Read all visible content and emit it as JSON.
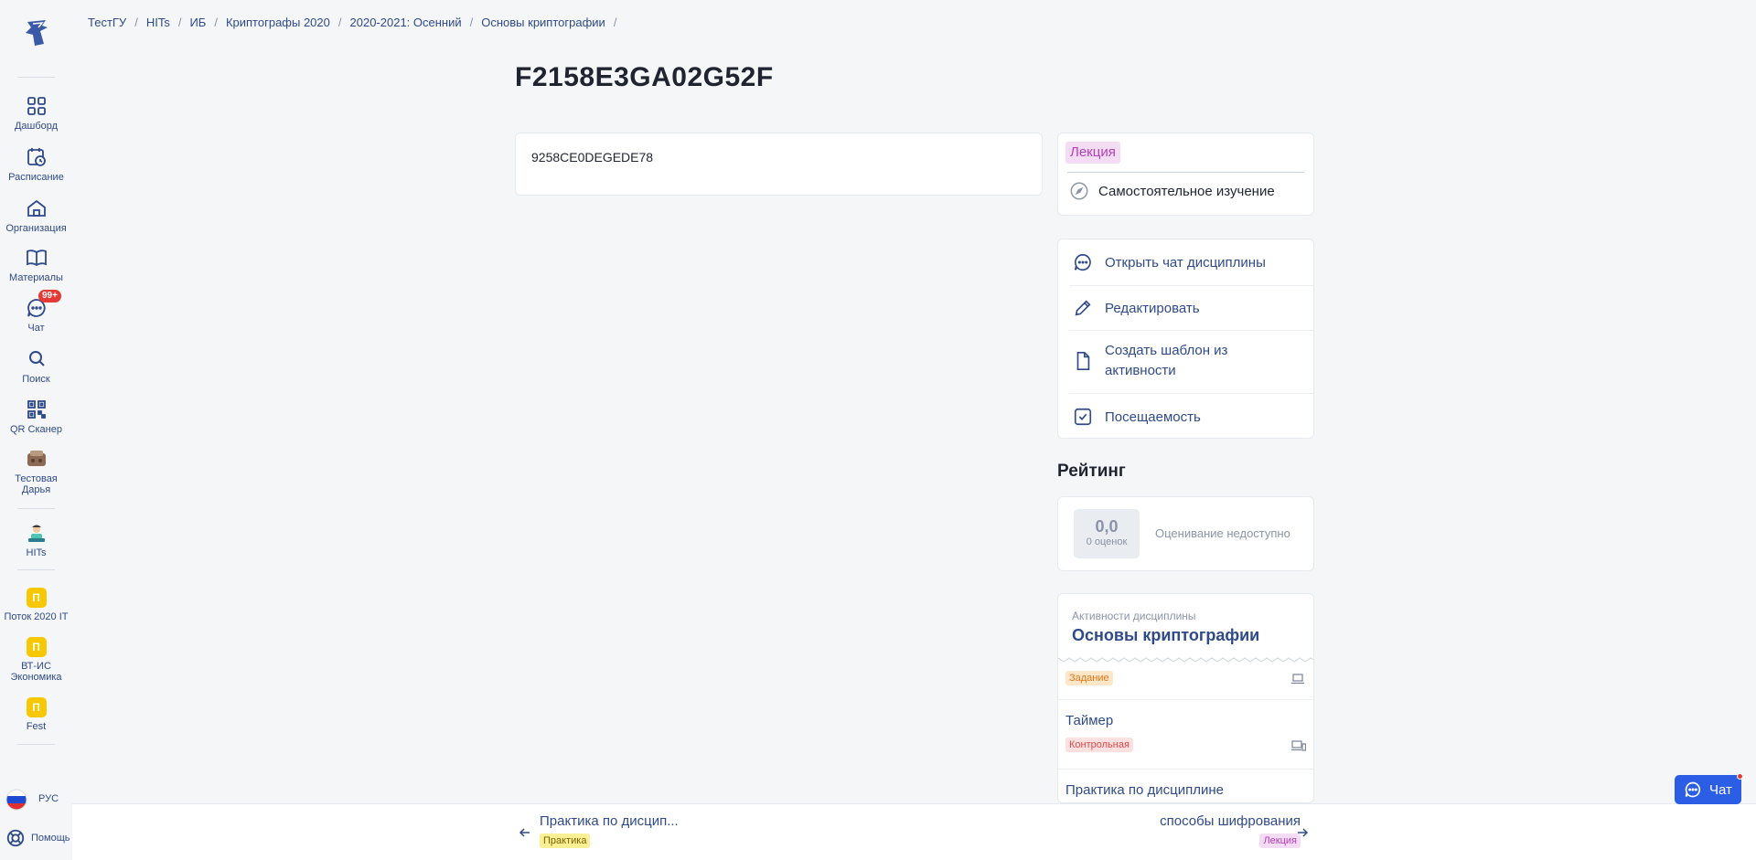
{
  "sidebar": {
    "items": [
      {
        "label": "Дашборд",
        "icon": "grid-icon"
      },
      {
        "label": "Расписание",
        "icon": "calendar-icon"
      },
      {
        "label": "Организация",
        "icon": "organization-icon"
      },
      {
        "label": "Материалы",
        "icon": "book-icon"
      },
      {
        "label": "Чат",
        "icon": "chat-icon",
        "badge": "99+"
      },
      {
        "label": "Поиск",
        "icon": "search-icon"
      },
      {
        "label": "QR Сканер",
        "icon": "qr-icon"
      },
      {
        "label": "Тестовая Дарья",
        "icon": "avatar-icon"
      },
      {
        "label": "HITs",
        "icon": "hits-avatar-icon"
      },
      {
        "label": "Поток 2020 IT",
        "letter": "П"
      },
      {
        "label": "ВТ-ИС Экономика",
        "letter": "П"
      },
      {
        "label": "Fest",
        "letter": "П"
      }
    ],
    "language": "РУС",
    "help": "Помощь"
  },
  "breadcrumb": [
    "ТестГУ",
    "HITs",
    "ИБ",
    "Криптографы 2020",
    "2020-2021: Осенний",
    "Основы криптографии"
  ],
  "page": {
    "title": "F2158E3GA02G52F",
    "content_text": "9258CE0DEGEDE78"
  },
  "info": {
    "type_tag": "Лекция",
    "mode": "Самостоятельное изучение"
  },
  "actions": [
    {
      "label": "Открыть чат дисциплины",
      "icon": "chat-icon"
    },
    {
      "label": "Редактировать",
      "icon": "pencil-icon"
    },
    {
      "label": "Создать шаблон из активности",
      "icon": "document-icon"
    },
    {
      "label": "Посещаемость",
      "icon": "checkbox-icon"
    }
  ],
  "rating": {
    "heading": "Рейтинг",
    "score": "0,0",
    "count": "0 оценок",
    "status": "Оценивание недоступно"
  },
  "discipline": {
    "subtitle": "Активности дисциплины",
    "title": "Основы криптографии",
    "items": [
      {
        "title": "",
        "tag": "Задание"
      },
      {
        "title": "Таймер",
        "tag": "Контрольная"
      },
      {
        "title": "Практика по дисциплине",
        "tag": ""
      }
    ]
  },
  "bottom_nav": {
    "prev": {
      "title": "Практика по дисцип...",
      "tag": "Практика"
    },
    "next": {
      "title": "способы шифрования",
      "tag": "Лекция"
    }
  },
  "chat_button": "Чат",
  "colors": {
    "accent": "#2f4a8a",
    "chat_button": "#2c5de5",
    "badge": "#e53935"
  }
}
